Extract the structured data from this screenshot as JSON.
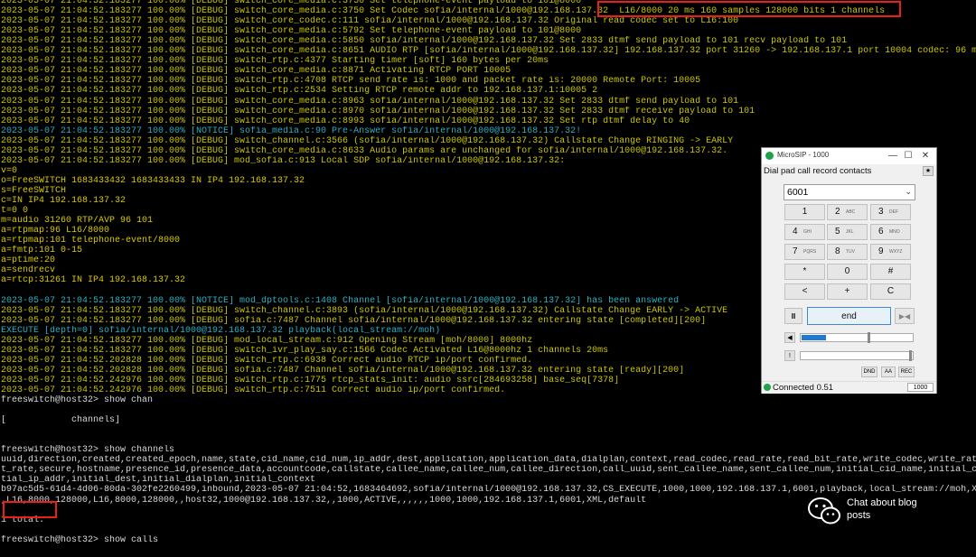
{
  "terminal": {
    "lines": [
      {
        "text": "2023-05-07 21:04:52.183277 100.00% [DEBUG] switch_core_media.c:3750 Set telephone-event payload to 101@8000",
        "kind": "debug"
      },
      {
        "text": "2023-05-07 21:04:52.183277 100.00% [DEBUG] switch_core_media.c:3750 Set Codec sofia/internal/1000@192.168.137.32  L16/8000 20 ms 160 samples 128000 bits 1 channels",
        "kind": "debug"
      },
      {
        "text": "2023-05-07 21:04:52.183277 100.00% [DEBUG] switch_core_codec.c:111 sofia/internal/1000@192.168.137.32 Original read codec set to L16:100",
        "kind": "debug"
      },
      {
        "text": "2023-05-07 21:04:52.183277 100.00% [DEBUG] switch_core_media.c:5792 Set telephone-event payload to 101@8000",
        "kind": "debug"
      },
      {
        "text": "2023-05-07 21:04:52.183277 100.00% [DEBUG] switch_core_media.c:5850 sofia/internal/1000@192.168.137.32 Set 2833 dtmf send payload to 101 recv payload to 101",
        "kind": "debug"
      },
      {
        "text": "2023-05-07 21:04:52.183277 100.00% [DEBUG] switch_core_media.c:8651 AUDIO RTP [sofia/internal/1000@192.168.137.32] 192.168.137.32 port 31260 -> 192.168.137.1 port 10004 codec: 96 ms: 20",
        "kind": "debug"
      },
      {
        "text": "2023-05-07 21:04:52.183277 100.00% [DEBUG] switch_rtp.c:4377 Starting timer [soft] 160 bytes per 20ms",
        "kind": "debug"
      },
      {
        "text": "2023-05-07 21:04:52.183277 100.00% [DEBUG] switch_core_media.c:8871 Activating RTCP PORT 10005",
        "kind": "debug"
      },
      {
        "text": "2023-05-07 21:04:52.183277 100.00% [DEBUG] switch_rtp.c:4708 RTCP send rate is: 1000 and packet rate is: 20000 Remote Port: 10005",
        "kind": "debug"
      },
      {
        "text": "2023-05-07 21:04:52.183277 100.00% [DEBUG] switch_rtp.c:2534 Setting RTCP remote addr to 192.168.137.1:10005 2",
        "kind": "debug"
      },
      {
        "text": "2023-05-07 21:04:52.183277 100.00% [DEBUG] switch_core_media.c:8963 sofia/internal/1000@192.168.137.32 Set 2833 dtmf send payload to 101",
        "kind": "debug"
      },
      {
        "text": "2023-05-07 21:04:52.183277 100.00% [DEBUG] switch_core_media.c:8970 sofia/internal/1000@192.168.137.32 Set 2833 dtmf receive payload to 101",
        "kind": "debug"
      },
      {
        "text": "2023-05-07 21:04:52.183277 100.00% [DEBUG] switch_core_media.c:8993 sofia/internal/1000@192.168.137.32 Set rtp dtmf delay to 40",
        "kind": "debug"
      },
      {
        "text": "2023-05-07 21:04:52.183277 100.00% [NOTICE] sofia_media.c:90 Pre-Answer sofia/internal/1000@192.168.137.32!",
        "kind": "notice"
      },
      {
        "text": "2023-05-07 21:04:52.183277 100.00% [DEBUG] switch_channel.c:3566 (sofia/internal/1000@192.168.137.32) Callstate Change RINGING -> EARLY",
        "kind": "debug"
      },
      {
        "text": "2023-05-07 21:04:52.183277 100.00% [DEBUG] switch_core_media.c:8633 Audio params are unchanged for sofia/internal/1000@192.168.137.32.",
        "kind": "debug"
      },
      {
        "text": "2023-05-07 21:04:52.183277 100.00% [DEBUG] mod_sofia.c:913 Local SDP sofia/internal/1000@192.168.137.32:",
        "kind": "debug"
      },
      {
        "text": "v=0",
        "kind": "sdp"
      },
      {
        "text": "o=FreeSWITCH 1683433432 1683433433 IN IP4 192.168.137.32",
        "kind": "sdp"
      },
      {
        "text": "s=FreeSWITCH",
        "kind": "sdp"
      },
      {
        "text": "c=IN IP4 192.168.137.32",
        "kind": "sdp"
      },
      {
        "text": "t=0 0",
        "kind": "sdp"
      },
      {
        "text": "m=audio 31260 RTP/AVP 96 101",
        "kind": "sdp"
      },
      {
        "text": "a=rtpmap:96 L16/8000",
        "kind": "sdp"
      },
      {
        "text": "a=rtpmap:101 telephone-event/8000",
        "kind": "sdp"
      },
      {
        "text": "a=fmtp:101 0-15",
        "kind": "sdp"
      },
      {
        "text": "a=ptime:20",
        "kind": "sdp"
      },
      {
        "text": "a=sendrecv",
        "kind": "sdp"
      },
      {
        "text": "a=rtcp:31261 IN IP4 192.168.137.32",
        "kind": "sdp"
      },
      {
        "text": "",
        "kind": "plain"
      },
      {
        "text": "2023-05-07 21:04:52.183277 100.00% [NOTICE] mod_dptools.c:1408 Channel [sofia/internal/1000@192.168.137.32] has been answered",
        "kind": "notice"
      },
      {
        "text": "2023-05-07 21:04:52.183277 100.00% [DEBUG] switch_channel.c:3893 (sofia/internal/1000@192.168.137.32) Callstate Change EARLY -> ACTIVE",
        "kind": "debug"
      },
      {
        "text": "2023-05-07 21:04:52.183277 100.00% [DEBUG] sofia.c:7487 Channel sofia/internal/1000@192.168.137.32 entering state [completed][200]",
        "kind": "debug"
      },
      {
        "text": "EXECUTE [depth=0] sofia/internal/1000@192.168.137.32 playback(local_stream://moh)",
        "kind": "exec"
      },
      {
        "text": "2023-05-07 21:04:52.183277 100.00% [DEBUG] mod_local_stream.c:912 Opening Stream [moh/8000] 8000hz",
        "kind": "debug"
      },
      {
        "text": "2023-05-07 21:04:52.183277 100.00% [DEBUG] switch_ivr_play_say.c:1566 Codec Activated L16@8000hz 1 channels 20ms",
        "kind": "debug"
      },
      {
        "text": "2023-05-07 21:04:52.202828 100.00% [DEBUG] switch_rtp.c:6938 Correct audio RTCP ip/port confirmed.",
        "kind": "debug"
      },
      {
        "text": "2023-05-07 21:04:52.202828 100.00% [DEBUG] sofia.c:7487 Channel sofia/internal/1000@192.168.137.32 entering state [ready][200]",
        "kind": "debug"
      },
      {
        "text": "2023-05-07 21:04:52.242976 100.00% [DEBUG] switch_rtp.c:1775 rtcp_stats_init: audio ssrc[284693258] base_seq[7378]",
        "kind": "debug"
      },
      {
        "text": "2023-05-07 21:04:52.242976 100.00% [DEBUG] switch_rtp.c:7511 Correct audio ip/port confirmed.",
        "kind": "debug"
      },
      {
        "text": "freeswitch@host32> show chan",
        "kind": "plain"
      },
      {
        "text": "",
        "kind": "plain"
      },
      {
        "text": "[            channels]",
        "kind": "plain"
      },
      {
        "text": "",
        "kind": "plain"
      },
      {
        "text": "",
        "kind": "plain"
      },
      {
        "text": "freeswitch@host32> show channels",
        "kind": "plain"
      },
      {
        "text": "uuid,direction,created,created_epoch,name,state,cid_name,cid_num,ip_addr,dest,application,application_data,dialplan,context,read_codec,read_rate,read_bit_rate,write_codec,write_rate,write_bi",
        "kind": "plain"
      },
      {
        "text": "t_rate,secure,hostname,presence_id,presence_data,accountcode,callstate,callee_name,callee_num,callee_direction,call_uuid,sent_callee_name,sent_callee_num,initial_cid_name,initial_cid_num,ini",
        "kind": "plain"
      },
      {
        "text": "tial_ip_addr,initial_dest,initial_dialplan,initial_context",
        "kind": "plain"
      },
      {
        "text": "b97ac5d5-61d4-4d06-80da-302fe2260499,inbound,2023-05-07 21:04:52,1683464692,sofia/internal/1000@192.168.137.32,CS_EXECUTE,1000,1000,192.168.137.1,6001,playback,local_stream://moh,XML,public",
        "kind": "plain"
      },
      {
        "text": ",L16,8000,128000,L16,8000,128000,,host32,1000@192.168.137.32,,1000,ACTIVE,,,,,,1000,1000,192.168.137.1,6001,XML,default",
        "kind": "plain"
      },
      {
        "text": "",
        "kind": "plain"
      },
      {
        "text": "1 total.",
        "kind": "plain"
      },
      {
        "text": "",
        "kind": "plain"
      },
      {
        "text": "freeswitch@host32> show calls",
        "kind": "plain"
      }
    ]
  },
  "microsip": {
    "title": "MicroSIP - 1000",
    "menu": "Dial pad call record contacts",
    "star_label": "★",
    "dial_value": "6001",
    "keys": [
      {
        "main": "1",
        "sub": ""
      },
      {
        "main": "2",
        "sub": "ABC"
      },
      {
        "main": "3",
        "sub": "DEF"
      },
      {
        "main": "4",
        "sub": "GHI"
      },
      {
        "main": "5",
        "sub": "JKL"
      },
      {
        "main": "6",
        "sub": "MNO"
      },
      {
        "main": "7",
        "sub": "PQRS"
      },
      {
        "main": "8",
        "sub": "TUV"
      },
      {
        "main": "9",
        "sub": "WXYZ"
      },
      {
        "main": "*",
        "sub": ""
      },
      {
        "main": "0",
        "sub": ""
      },
      {
        "main": "#",
        "sub": ""
      },
      {
        "main": "<",
        "sub": ""
      },
      {
        "main": "+",
        "sub": ""
      },
      {
        "main": "C",
        "sub": ""
      }
    ],
    "hold_label": "II",
    "end_label": "end",
    "transfer_label": "▶◀",
    "speaker_label": "◀",
    "mic_label": "!",
    "speaker_level": 0.22,
    "buttons_small": [
      "DND",
      "AA",
      "REC"
    ],
    "status_text": "Connected 0.51",
    "status_ext": "1000"
  },
  "watermark": {
    "text": "Chat about blog posts"
  }
}
